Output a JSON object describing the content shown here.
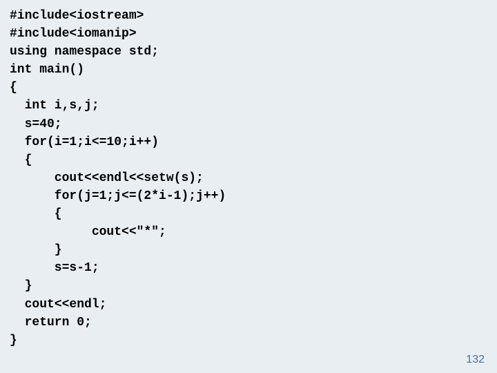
{
  "code": {
    "lines": [
      "#include<iostream>",
      "#include<iomanip>",
      "using namespace std;",
      "int main()",
      "{",
      "  int i,s,j;",
      "  s=40;",
      "  for(i=1;i<=10;i++)",
      "  {",
      "      cout<<endl<<setw(s);",
      "      for(j=1;j<=(2*i-1);j++)",
      "      {",
      "           cout<<\"*\";",
      "      }",
      "      s=s-1;",
      "  }",
      "  cout<<endl;",
      "  return 0;",
      "}"
    ]
  },
  "page_number": "132"
}
